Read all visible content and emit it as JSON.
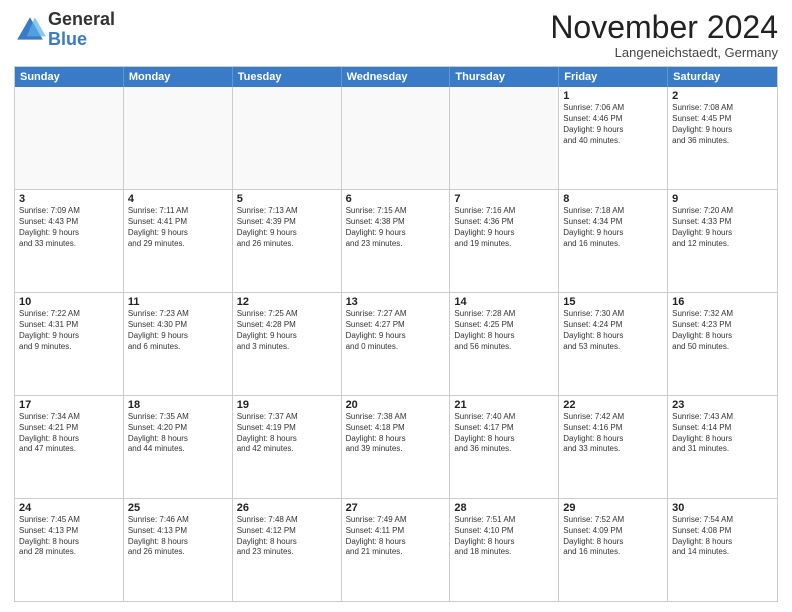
{
  "logo": {
    "general": "General",
    "blue": "Blue"
  },
  "title": "November 2024",
  "location": "Langeneichstaedt, Germany",
  "weekdays": [
    "Sunday",
    "Monday",
    "Tuesday",
    "Wednesday",
    "Thursday",
    "Friday",
    "Saturday"
  ],
  "weeks": [
    [
      {
        "day": "",
        "info": ""
      },
      {
        "day": "",
        "info": ""
      },
      {
        "day": "",
        "info": ""
      },
      {
        "day": "",
        "info": ""
      },
      {
        "day": "",
        "info": ""
      },
      {
        "day": "1",
        "info": "Sunrise: 7:06 AM\nSunset: 4:46 PM\nDaylight: 9 hours\nand 40 minutes."
      },
      {
        "day": "2",
        "info": "Sunrise: 7:08 AM\nSunset: 4:45 PM\nDaylight: 9 hours\nand 36 minutes."
      }
    ],
    [
      {
        "day": "3",
        "info": "Sunrise: 7:09 AM\nSunset: 4:43 PM\nDaylight: 9 hours\nand 33 minutes."
      },
      {
        "day": "4",
        "info": "Sunrise: 7:11 AM\nSunset: 4:41 PM\nDaylight: 9 hours\nand 29 minutes."
      },
      {
        "day": "5",
        "info": "Sunrise: 7:13 AM\nSunset: 4:39 PM\nDaylight: 9 hours\nand 26 minutes."
      },
      {
        "day": "6",
        "info": "Sunrise: 7:15 AM\nSunset: 4:38 PM\nDaylight: 9 hours\nand 23 minutes."
      },
      {
        "day": "7",
        "info": "Sunrise: 7:16 AM\nSunset: 4:36 PM\nDaylight: 9 hours\nand 19 minutes."
      },
      {
        "day": "8",
        "info": "Sunrise: 7:18 AM\nSunset: 4:34 PM\nDaylight: 9 hours\nand 16 minutes."
      },
      {
        "day": "9",
        "info": "Sunrise: 7:20 AM\nSunset: 4:33 PM\nDaylight: 9 hours\nand 12 minutes."
      }
    ],
    [
      {
        "day": "10",
        "info": "Sunrise: 7:22 AM\nSunset: 4:31 PM\nDaylight: 9 hours\nand 9 minutes."
      },
      {
        "day": "11",
        "info": "Sunrise: 7:23 AM\nSunset: 4:30 PM\nDaylight: 9 hours\nand 6 minutes."
      },
      {
        "day": "12",
        "info": "Sunrise: 7:25 AM\nSunset: 4:28 PM\nDaylight: 9 hours\nand 3 minutes."
      },
      {
        "day": "13",
        "info": "Sunrise: 7:27 AM\nSunset: 4:27 PM\nDaylight: 9 hours\nand 0 minutes."
      },
      {
        "day": "14",
        "info": "Sunrise: 7:28 AM\nSunset: 4:25 PM\nDaylight: 8 hours\nand 56 minutes."
      },
      {
        "day": "15",
        "info": "Sunrise: 7:30 AM\nSunset: 4:24 PM\nDaylight: 8 hours\nand 53 minutes."
      },
      {
        "day": "16",
        "info": "Sunrise: 7:32 AM\nSunset: 4:23 PM\nDaylight: 8 hours\nand 50 minutes."
      }
    ],
    [
      {
        "day": "17",
        "info": "Sunrise: 7:34 AM\nSunset: 4:21 PM\nDaylight: 8 hours\nand 47 minutes."
      },
      {
        "day": "18",
        "info": "Sunrise: 7:35 AM\nSunset: 4:20 PM\nDaylight: 8 hours\nand 44 minutes."
      },
      {
        "day": "19",
        "info": "Sunrise: 7:37 AM\nSunset: 4:19 PM\nDaylight: 8 hours\nand 42 minutes."
      },
      {
        "day": "20",
        "info": "Sunrise: 7:38 AM\nSunset: 4:18 PM\nDaylight: 8 hours\nand 39 minutes."
      },
      {
        "day": "21",
        "info": "Sunrise: 7:40 AM\nSunset: 4:17 PM\nDaylight: 8 hours\nand 36 minutes."
      },
      {
        "day": "22",
        "info": "Sunrise: 7:42 AM\nSunset: 4:16 PM\nDaylight: 8 hours\nand 33 minutes."
      },
      {
        "day": "23",
        "info": "Sunrise: 7:43 AM\nSunset: 4:14 PM\nDaylight: 8 hours\nand 31 minutes."
      }
    ],
    [
      {
        "day": "24",
        "info": "Sunrise: 7:45 AM\nSunset: 4:13 PM\nDaylight: 8 hours\nand 28 minutes."
      },
      {
        "day": "25",
        "info": "Sunrise: 7:46 AM\nSunset: 4:13 PM\nDaylight: 8 hours\nand 26 minutes."
      },
      {
        "day": "26",
        "info": "Sunrise: 7:48 AM\nSunset: 4:12 PM\nDaylight: 8 hours\nand 23 minutes."
      },
      {
        "day": "27",
        "info": "Sunrise: 7:49 AM\nSunset: 4:11 PM\nDaylight: 8 hours\nand 21 minutes."
      },
      {
        "day": "28",
        "info": "Sunrise: 7:51 AM\nSunset: 4:10 PM\nDaylight: 8 hours\nand 18 minutes."
      },
      {
        "day": "29",
        "info": "Sunrise: 7:52 AM\nSunset: 4:09 PM\nDaylight: 8 hours\nand 16 minutes."
      },
      {
        "day": "30",
        "info": "Sunrise: 7:54 AM\nSunset: 4:08 PM\nDaylight: 8 hours\nand 14 minutes."
      }
    ]
  ]
}
